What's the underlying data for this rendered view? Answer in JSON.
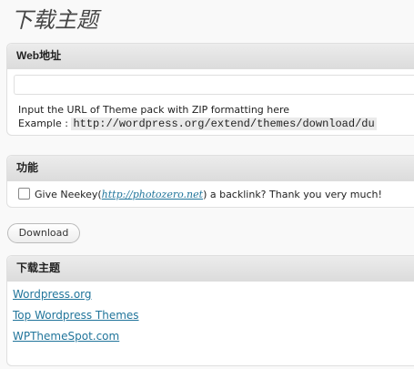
{
  "page": {
    "title": "下载主题"
  },
  "url_section": {
    "heading": "Web地址",
    "input_value": "",
    "help_line": "Input the URL of Theme pack with ZIP formatting here",
    "example_label": "Example :",
    "example_url": "http://wordpress.org/extend/themes/download/du"
  },
  "feature_section": {
    "heading": "功能",
    "checkbox_prefix": "Give Neekey(",
    "checkbox_link": "http://photozero.net",
    "checkbox_suffix": ") a backlink? Thank you very much!",
    "checked": false
  },
  "actions": {
    "download_label": "Download"
  },
  "links_section": {
    "heading": "下载主题",
    "links": [
      {
        "label": "Wordpress.org"
      },
      {
        "label": "Top Wordpress Themes"
      },
      {
        "label": "WPThemeSpot.com"
      }
    ]
  },
  "colors": {
    "link": "#21759b",
    "panel_header": "#dcdcdc",
    "background": "#f9f9f9"
  }
}
